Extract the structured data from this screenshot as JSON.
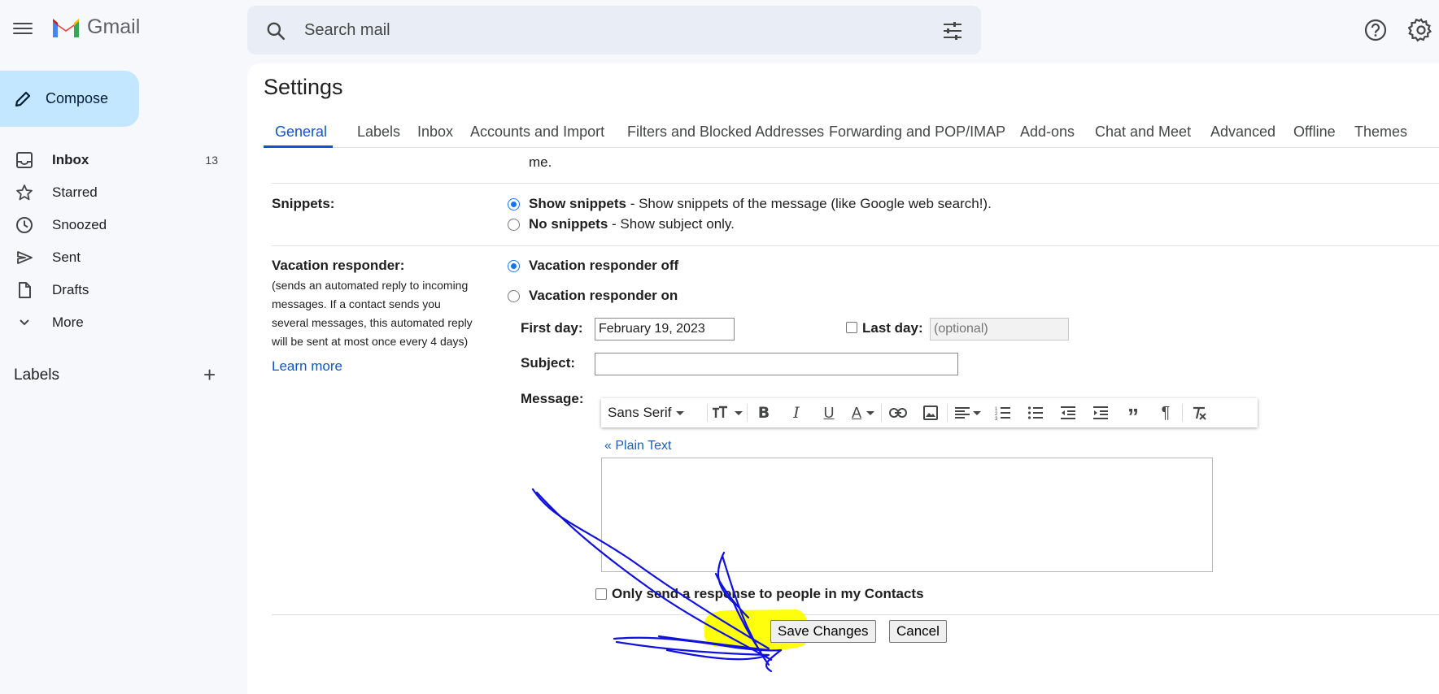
{
  "app": {
    "name": "Gmail",
    "search_placeholder": "Search mail"
  },
  "sidebar": {
    "compose_label": "Compose",
    "items": [
      {
        "label": "Inbox",
        "count": "13",
        "icon": "inbox-icon"
      },
      {
        "label": "Starred",
        "count": "",
        "icon": "star-icon"
      },
      {
        "label": "Snoozed",
        "count": "",
        "icon": "clock-icon"
      },
      {
        "label": "Sent",
        "count": "",
        "icon": "send-icon"
      },
      {
        "label": "Drafts",
        "count": "",
        "icon": "draft-icon"
      },
      {
        "label": "More",
        "count": "",
        "icon": "chevron-down-icon"
      }
    ],
    "labels_heading": "Labels"
  },
  "settings": {
    "title": "Settings",
    "tabs": [
      "General",
      "Labels",
      "Inbox",
      "Accounts and Import",
      "Filters and Blocked Addresses",
      "Forwarding and POP/IMAP",
      "Add-ons",
      "Chat and Meet",
      "Advanced",
      "Offline",
      "Themes"
    ],
    "active_tab": "General",
    "me_text": "me.",
    "snippets": {
      "label": "Snippets:",
      "options": [
        {
          "title": "Show snippets",
          "desc": " - Show snippets of the message (like Google web search!).",
          "selected": true
        },
        {
          "title": "No snippets",
          "desc": " - Show subject only.",
          "selected": false
        }
      ]
    },
    "vacation": {
      "label": "Vacation responder:",
      "description": "(sends an automated reply to incoming messages. If a contact sends you several messages, this automated reply will be sent at most once every 4 days)",
      "learn_more": "Learn more",
      "off_label": "Vacation responder off",
      "on_label": "Vacation responder on",
      "off_selected": true,
      "first_day_label": "First day:",
      "first_day_value": "February 19, 2023",
      "last_day_label": "Last day:",
      "last_day_placeholder": "(optional)",
      "subject_label": "Subject:",
      "subject_value": "",
      "message_label": "Message:",
      "font_name": "Sans Serif",
      "plain_text_link": "« Plain Text",
      "contacts_only_label": "Only send a response to people in my Contacts"
    },
    "buttons": {
      "save": "Save Changes",
      "cancel": "Cancel"
    }
  },
  "colors": {
    "accent": "#0b57d0",
    "compose_bg": "#c2e7ff",
    "highlight": "#ffff00",
    "annotation_ink": "#1010e0"
  }
}
